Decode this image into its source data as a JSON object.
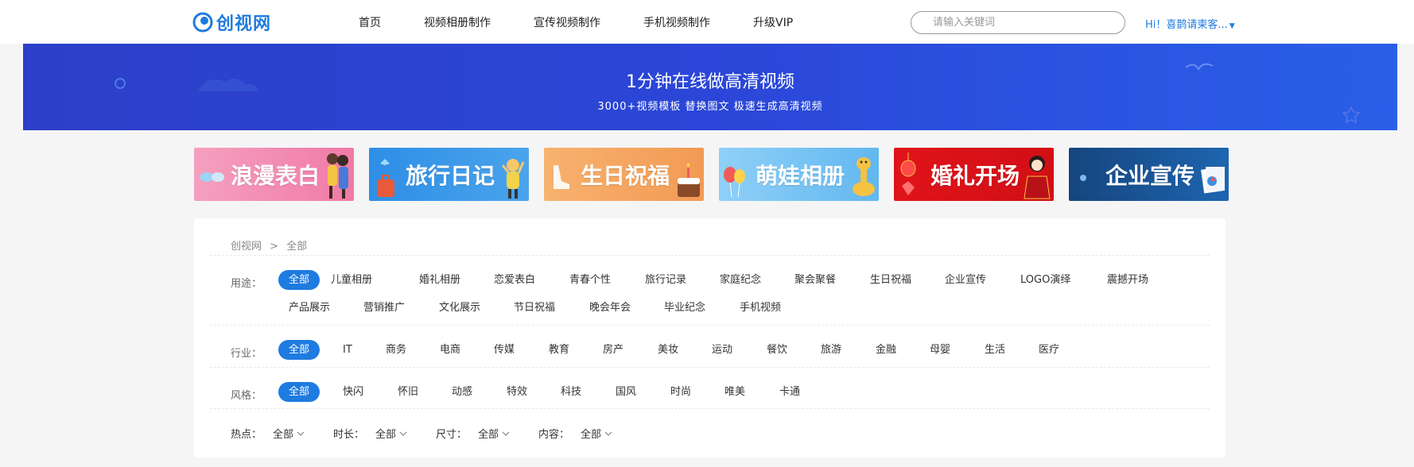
{
  "header": {
    "logo_text": "创视网",
    "nav": [
      "首页",
      "视频相册制作",
      "宣传视频制作",
      "手机视频制作",
      "升级VIP"
    ],
    "search_placeholder": "请输入关键词",
    "user_text": "Hi！喜鹊请柬客..."
  },
  "banner": {
    "title": "1分钟在线做高清视频",
    "subtitle": "3000+视频模板  替换图文  极速生成高清视频"
  },
  "cards": [
    {
      "label": "浪漫表白",
      "bg": "#f28ab0",
      "icon": "couple-icon"
    },
    {
      "label": "旅行日记",
      "bg": "#3a95e6",
      "icon": "suitcase-icon"
    },
    {
      "label": "生日祝福",
      "bg": "#f4a45e",
      "icon": "cake-icon"
    },
    {
      "label": "萌娃相册",
      "bg": "#72c3f4",
      "icon": "giraffe-icon"
    },
    {
      "label": "婚礼开场",
      "bg": "#d8161c",
      "icon": "bride-icon"
    },
    {
      "label": "企业宣传",
      "bg": "#1c5aa0",
      "icon": "documents-icon"
    }
  ],
  "breadcrumb": {
    "root": "创视网",
    "sep": ">",
    "current": "全部"
  },
  "filters": {
    "usage": {
      "label": "用途：",
      "row1": [
        "全部",
        "儿童相册",
        "婚礼相册",
        "恋爱表白",
        "青春个性",
        "旅行记录",
        "家庭纪念",
        "聚会聚餐",
        "生日祝福",
        "企业宣传",
        "LOGO演绎",
        "震撼开场"
      ],
      "row2": [
        "产品展示",
        "营销推广",
        "文化展示",
        "节日祝福",
        "晚会年会",
        "毕业纪念",
        "手机视频"
      ]
    },
    "industry": {
      "label": "行业：",
      "items": [
        "全部",
        "IT",
        "商务",
        "电商",
        "传媒",
        "教育",
        "房产",
        "美妆",
        "运动",
        "餐饮",
        "旅游",
        "金融",
        "母婴",
        "生活",
        "医疗"
      ]
    },
    "style": {
      "label": "风格：",
      "items": [
        "全部",
        "快闪",
        "怀旧",
        "动感",
        "特效",
        "科技",
        "国风",
        "时尚",
        "唯美",
        "卡通"
      ]
    },
    "dropdowns": [
      {
        "label": "热点：",
        "value": "全部"
      },
      {
        "label": "时长：",
        "value": "全部"
      },
      {
        "label": "尺寸：",
        "value": "全部"
      },
      {
        "label": "内容：",
        "value": "全部"
      }
    ]
  },
  "colors": {
    "accent": "#1e7be0",
    "banner_start": "#2c3fc8",
    "banner_end": "#2a5fe8"
  }
}
